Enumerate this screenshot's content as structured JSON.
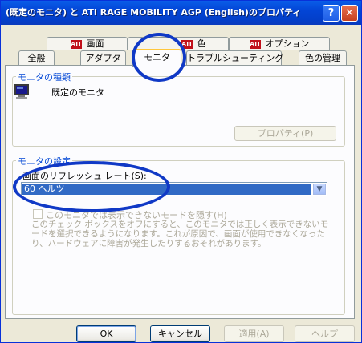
{
  "window": {
    "title": "(既定のモニタ) と ATI RAGE MOBILITY AGP (English)のプロパティ",
    "help_glyph": "?",
    "close_glyph": "✕"
  },
  "tabs_top": [
    {
      "label": "画面",
      "icon": "ati-logo-icon"
    },
    {
      "label": "色",
      "icon": "ati-logo-icon"
    },
    {
      "label": "オプション",
      "icon": "ati-logo-icon"
    }
  ],
  "tabs_bottom": [
    {
      "label": "全般"
    },
    {
      "label": "アダプタ"
    },
    {
      "label": "モニタ",
      "active": true
    },
    {
      "label": "トラブルシューティング"
    },
    {
      "label": "色の管理"
    }
  ],
  "ati_badge": "ATI",
  "monitor_type": {
    "group_label": "モニタの種類",
    "monitor_name": "既定のモニタ",
    "properties_button": "プロパティ(P)"
  },
  "monitor_settings": {
    "group_label": "モニタの設定",
    "refresh_label": "画面のリフレッシュ レート(S):",
    "refresh_value": "60 ヘルツ",
    "hide_modes_label": "このモニタでは表示できないモードを隠す(H)",
    "hide_modes_checked": false,
    "description": "このチェック ボックスをオフにすると、このモニタでは正しく表示できないモードを選択できるようになります。これが原因で、画面が使用できなくなったり、ハードウェアに障害が発生したりするおそれがあります。"
  },
  "buttons": {
    "ok": "OK",
    "cancel": "キャンセル",
    "apply": "適用(A)",
    "help": "ヘルプ"
  },
  "colors": {
    "annotation_circle": "#1039c6",
    "selection": "#316ac5",
    "titlebar": "#0345d6"
  }
}
